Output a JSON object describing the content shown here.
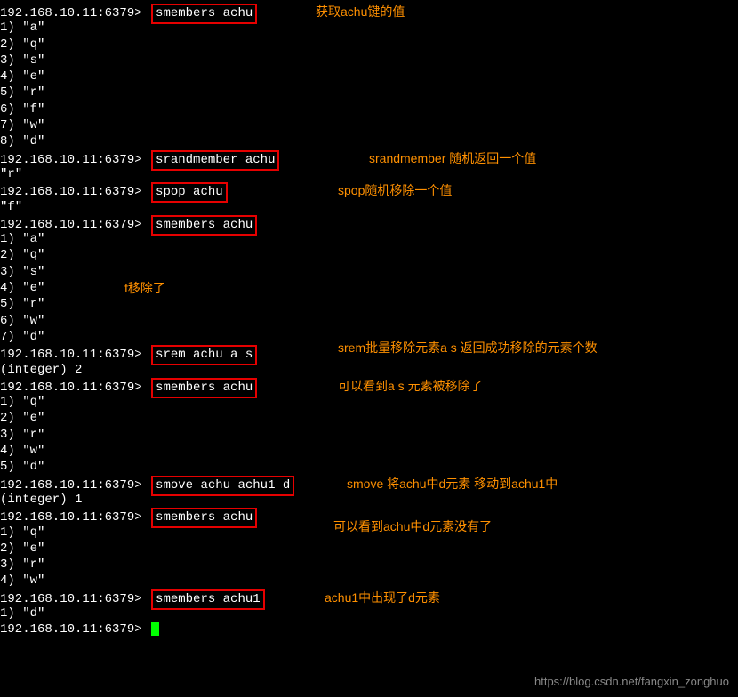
{
  "prompt": "192.168.10.11:6379>",
  "commands": {
    "smembers_achu": "smembers achu",
    "srandmember": "srandmember achu",
    "spop": "spop achu",
    "srem": "srem achu a s",
    "smove": "smove achu achu1 d",
    "smembers_achu1": "smembers achu1"
  },
  "results": {
    "set1_1": "1) \"a\"",
    "set1_2": "2) \"q\"",
    "set1_3": "3) \"s\"",
    "set1_4": "4) \"e\"",
    "set1_5": "5) \"r\"",
    "set1_6": "6) \"f\"",
    "set1_7": "7) \"w\"",
    "set1_8": "8) \"d\"",
    "srand_res": "\"r\"",
    "spop_res": "\"f\"",
    "set2_1": "1) \"a\"",
    "set2_2": "2) \"q\"",
    "set2_3": "3) \"s\"",
    "set2_4": "4) \"e\"",
    "set2_5": "5) \"r\"",
    "set2_6": "6) \"w\"",
    "set2_7": "7) \"d\"",
    "int2": "(integer) 2",
    "set3_1": "1) \"q\"",
    "set3_2": "2) \"e\"",
    "set3_3": "3) \"r\"",
    "set3_4": "4) \"w\"",
    "set3_5": "5) \"d\"",
    "int1": "(integer) 1",
    "set4_1": "1) \"q\"",
    "set4_2": "2) \"e\"",
    "set4_3": "3) \"r\"",
    "set4_4": "4) \"w\"",
    "set5_1": "1) \"d\""
  },
  "annotations": {
    "a1": "获取achu键的值",
    "a2": "srandmember 随机返回一个值",
    "a3": "spop随机移除一个值",
    "a4": "f移除了",
    "a5": "srem批量移除元素a s 返回成功移除的元素个数",
    "a6": "可以看到a s 元素被移除了",
    "a7": "smove 将achu中d元素 移动到achu1中",
    "a8": "可以看到achu中d元素没有了",
    "a9": "achu1中出现了d元素"
  },
  "watermark": "https://blog.csdn.net/fangxin_zonghuo"
}
